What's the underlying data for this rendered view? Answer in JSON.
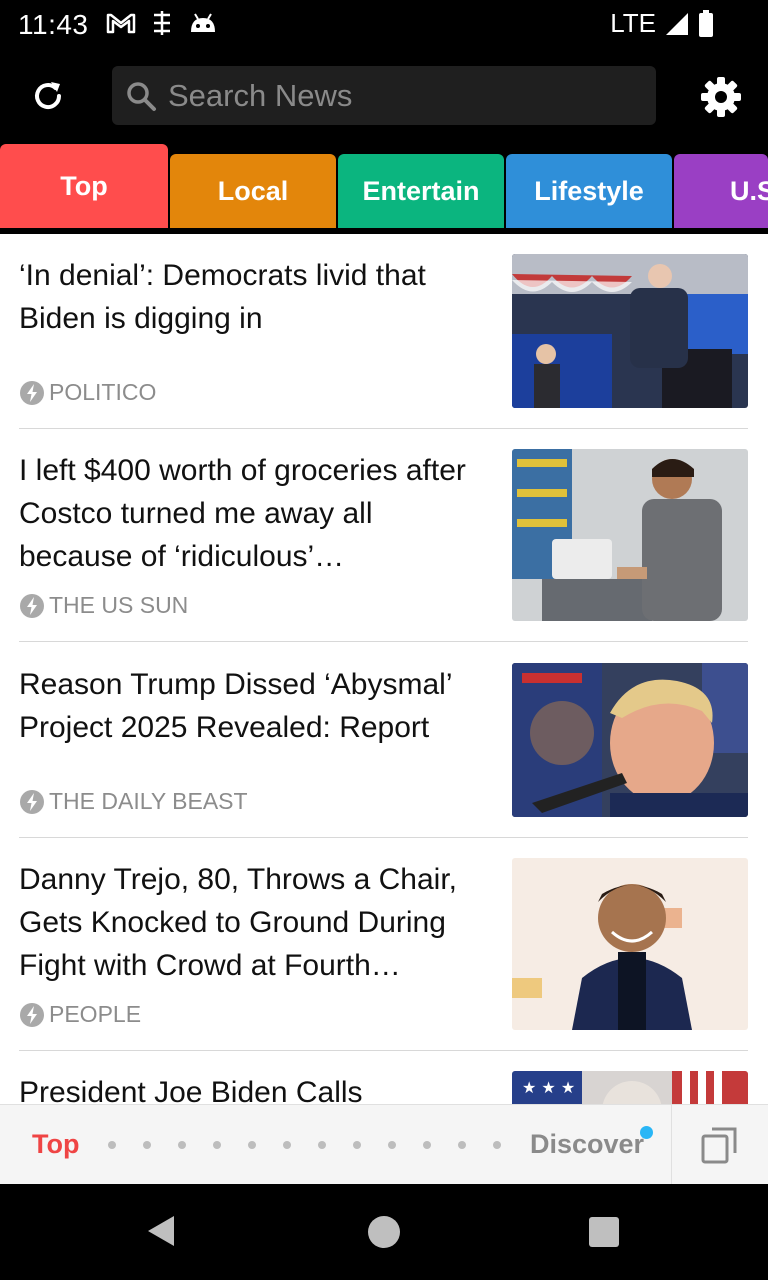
{
  "status_bar": {
    "time": "11:43",
    "network": "LTE",
    "left_icons": [
      "gmail-icon",
      "sync-icon",
      "android-icon"
    ],
    "right_icons": [
      "signal-icon",
      "battery-icon"
    ]
  },
  "app_bar": {
    "refresh_icon": "refresh-icon",
    "search_placeholder": "Search News",
    "settings_icon": "gear-icon"
  },
  "tabs": [
    {
      "label": "Top",
      "color": "#ff4d4d",
      "active": true
    },
    {
      "label": "Local",
      "color": "#e3860b",
      "active": false
    },
    {
      "label": "Entertain",
      "color": "#0bb57f",
      "active": false
    },
    {
      "label": "Lifestyle",
      "color": "#2f8fd9",
      "active": false
    },
    {
      "label": "U.S",
      "color": "#9a3fc4",
      "active": false
    }
  ],
  "news": [
    {
      "headline": "‘In denial’: Democrats livid that Biden is digging in",
      "source": "POLITICO"
    },
    {
      "headline": "I left $400 worth of groceries after Costco turned me away all because of ‘ridiculous’…",
      "source": "THE US SUN"
    },
    {
      "headline": "Reason Trump Dissed ‘Abysmal’ Project 2025 Revealed: Report",
      "source": "THE DAILY BEAST"
    },
    {
      "headline": "Danny Trejo, 80, Throws a Chair, Gets Knocked to Ground During Fight with Crowd at Fourth…",
      "source": "PEOPLE"
    },
    {
      "headline": "President Joe Biden Calls",
      "source": ""
    }
  ],
  "bottom_bar": {
    "top_label": "Top",
    "discover_label": "Discover",
    "dot_count": 12,
    "accent_color": "#ef4444",
    "badge_color": "#29b6f6"
  }
}
